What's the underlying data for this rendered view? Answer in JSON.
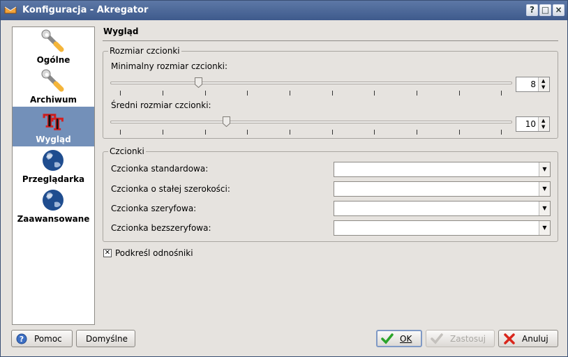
{
  "window": {
    "title": "Konfiguracja - Akregator",
    "controls": [
      "?",
      "□",
      "×"
    ]
  },
  "sidebar": {
    "items": [
      {
        "label": "Ogólne",
        "icon": "wrench-icon",
        "selected": false
      },
      {
        "label": "Archiwum",
        "icon": "wrench-icon",
        "selected": false
      },
      {
        "label": "Wygląd",
        "icon": "fonts-icon",
        "selected": true
      },
      {
        "label": "Przeglądarka",
        "icon": "globe-icon",
        "selected": false
      },
      {
        "label": "Zaawansowane",
        "icon": "globe-icon",
        "selected": false
      }
    ]
  },
  "page": {
    "title": "Wygląd"
  },
  "font_size_group": {
    "title": "Rozmiar czcionki",
    "min_label": "Minimalny rozmiar czcionki:",
    "min_value": "8",
    "avg_label": "Średni rozmiar czcionki:",
    "avg_value": "10"
  },
  "fonts_group": {
    "title": "Czcionki",
    "rows": [
      {
        "label": "Czcionka standardowa:",
        "value": ""
      },
      {
        "label": "Czcionka o stałej szerokości:",
        "value": ""
      },
      {
        "label": "Czcionka szeryfowa:",
        "value": ""
      },
      {
        "label": "Czcionka bezszeryfowa:",
        "value": ""
      }
    ]
  },
  "underline_links": {
    "label": "Podkreśl odnośniki",
    "checked": true
  },
  "buttons": {
    "help": "Pomoc",
    "defaults": "Domyślne",
    "ok": "OK",
    "apply": "Zastosuj",
    "cancel": "Anuluj"
  },
  "colors": {
    "titlebar": "#4a679a",
    "selection": "#7390b9",
    "ok": "#2aa42a",
    "cancel": "#d9261c"
  }
}
